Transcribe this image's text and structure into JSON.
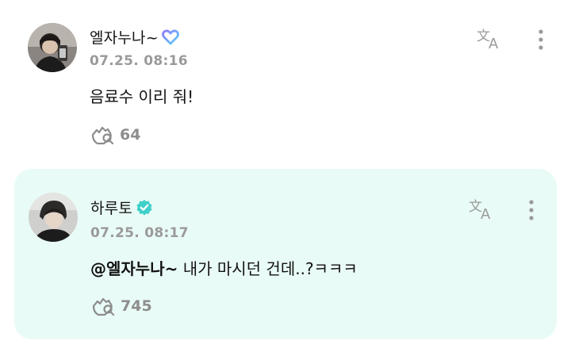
{
  "comments": [
    {
      "author": "엘자누나~",
      "author_badge": "heart-badge-icon",
      "timestamp": "07.25. 08:16",
      "text": "음료수 이리 줘!",
      "likes": "64",
      "highlighted": false
    },
    {
      "author": "하루토",
      "author_badge": "verified-badge-icon",
      "timestamp": "07.25. 08:17",
      "mention": "@엘자누나~",
      "text": " 내가 마시던 건데..?ㅋㅋㅋ",
      "likes": "745",
      "highlighted": true
    }
  ],
  "colors": {
    "highlight_bg": "#e9fbf6",
    "verified": "#3fd0c9",
    "heart_gradient_start": "#8e7bff",
    "heart_gradient_end": "#5ad1f5",
    "muted": "#9a9a9a"
  },
  "icons": {
    "translate": "translate-icon",
    "more": "more-vertical-icon",
    "like": "like-hand-icon"
  }
}
